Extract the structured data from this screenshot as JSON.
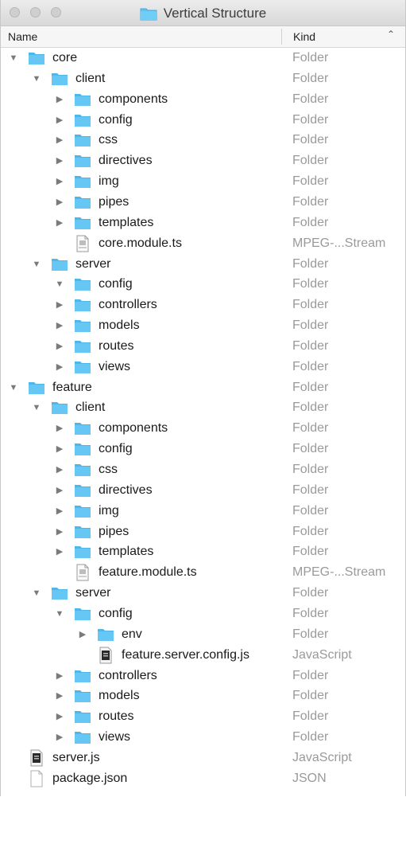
{
  "window": {
    "title": "Vertical Structure"
  },
  "header": {
    "name_label": "Name",
    "kind_label": "Kind"
  },
  "rows": [
    {
      "name": "core",
      "kind": "Folder",
      "level": 0,
      "icon": "folder-icon",
      "disclosure": "open"
    },
    {
      "name": "client",
      "kind": "Folder",
      "level": 1,
      "icon": "folder-icon",
      "disclosure": "open"
    },
    {
      "name": "components",
      "kind": "Folder",
      "level": 2,
      "icon": "folder-icon",
      "disclosure": "closed"
    },
    {
      "name": "config",
      "kind": "Folder",
      "level": 2,
      "icon": "folder-icon",
      "disclosure": "closed"
    },
    {
      "name": "css",
      "kind": "Folder",
      "level": 2,
      "icon": "folder-icon",
      "disclosure": "closed"
    },
    {
      "name": "directives",
      "kind": "Folder",
      "level": 2,
      "icon": "folder-icon",
      "disclosure": "closed"
    },
    {
      "name": "img",
      "kind": "Folder",
      "level": 2,
      "icon": "folder-icon",
      "disclosure": "closed"
    },
    {
      "name": "pipes",
      "kind": "Folder",
      "level": 2,
      "icon": "folder-icon",
      "disclosure": "closed"
    },
    {
      "name": "templates",
      "kind": "Folder",
      "level": 2,
      "icon": "folder-icon",
      "disclosure": "closed"
    },
    {
      "name": "core.module.ts",
      "kind": "MPEG-...Stream",
      "level": 2,
      "icon": "mpeg-file-icon",
      "disclosure": "none"
    },
    {
      "name": "server",
      "kind": "Folder",
      "level": 1,
      "icon": "folder-icon",
      "disclosure": "open"
    },
    {
      "name": "config",
      "kind": "Folder",
      "level": 2,
      "icon": "folder-icon",
      "disclosure": "open"
    },
    {
      "name": "controllers",
      "kind": "Folder",
      "level": 2,
      "icon": "folder-icon",
      "disclosure": "closed"
    },
    {
      "name": "models",
      "kind": "Folder",
      "level": 2,
      "icon": "folder-icon",
      "disclosure": "closed"
    },
    {
      "name": "routes",
      "kind": "Folder",
      "level": 2,
      "icon": "folder-icon",
      "disclosure": "closed"
    },
    {
      "name": "views",
      "kind": "Folder",
      "level": 2,
      "icon": "folder-icon",
      "disclosure": "closed"
    },
    {
      "name": "feature",
      "kind": "Folder",
      "level": 0,
      "icon": "folder-icon",
      "disclosure": "open"
    },
    {
      "name": "client",
      "kind": "Folder",
      "level": 1,
      "icon": "folder-icon",
      "disclosure": "open"
    },
    {
      "name": "components",
      "kind": "Folder",
      "level": 2,
      "icon": "folder-icon",
      "disclosure": "closed"
    },
    {
      "name": "config",
      "kind": "Folder",
      "level": 2,
      "icon": "folder-icon",
      "disclosure": "closed"
    },
    {
      "name": "css",
      "kind": "Folder",
      "level": 2,
      "icon": "folder-icon",
      "disclosure": "closed"
    },
    {
      "name": "directives",
      "kind": "Folder",
      "level": 2,
      "icon": "folder-icon",
      "disclosure": "closed"
    },
    {
      "name": "img",
      "kind": "Folder",
      "level": 2,
      "icon": "folder-icon",
      "disclosure": "closed"
    },
    {
      "name": "pipes",
      "kind": "Folder",
      "level": 2,
      "icon": "folder-icon",
      "disclosure": "closed"
    },
    {
      "name": "templates",
      "kind": "Folder",
      "level": 2,
      "icon": "folder-icon",
      "disclosure": "closed"
    },
    {
      "name": "feature.module.ts",
      "kind": "MPEG-...Stream",
      "level": 2,
      "icon": "mpeg-file-icon",
      "disclosure": "none"
    },
    {
      "name": "server",
      "kind": "Folder",
      "level": 1,
      "icon": "folder-icon",
      "disclosure": "open"
    },
    {
      "name": "config",
      "kind": "Folder",
      "level": 2,
      "icon": "folder-icon",
      "disclosure": "open"
    },
    {
      "name": "env",
      "kind": "Folder",
      "level": 3,
      "icon": "folder-icon",
      "disclosure": "closed"
    },
    {
      "name": "feature.server.config.js",
      "kind": "JavaScript",
      "level": 3,
      "icon": "js-file-icon",
      "disclosure": "none"
    },
    {
      "name": "controllers",
      "kind": "Folder",
      "level": 2,
      "icon": "folder-icon",
      "disclosure": "closed"
    },
    {
      "name": "models",
      "kind": "Folder",
      "level": 2,
      "icon": "folder-icon",
      "disclosure": "closed"
    },
    {
      "name": "routes",
      "kind": "Folder",
      "level": 2,
      "icon": "folder-icon",
      "disclosure": "closed"
    },
    {
      "name": "views",
      "kind": "Folder",
      "level": 2,
      "icon": "folder-icon",
      "disclosure": "closed"
    },
    {
      "name": "server.js",
      "kind": "JavaScript",
      "level": 0,
      "icon": "js-file-icon",
      "disclosure": "none"
    },
    {
      "name": "package.json",
      "kind": "JSON",
      "level": 0,
      "icon": "blank-file-icon",
      "disclosure": "none"
    }
  ],
  "colors": {
    "folder": "#5ec3f2",
    "folder_dark": "#3fa9e2",
    "kind_text": "#9a9a9a"
  }
}
